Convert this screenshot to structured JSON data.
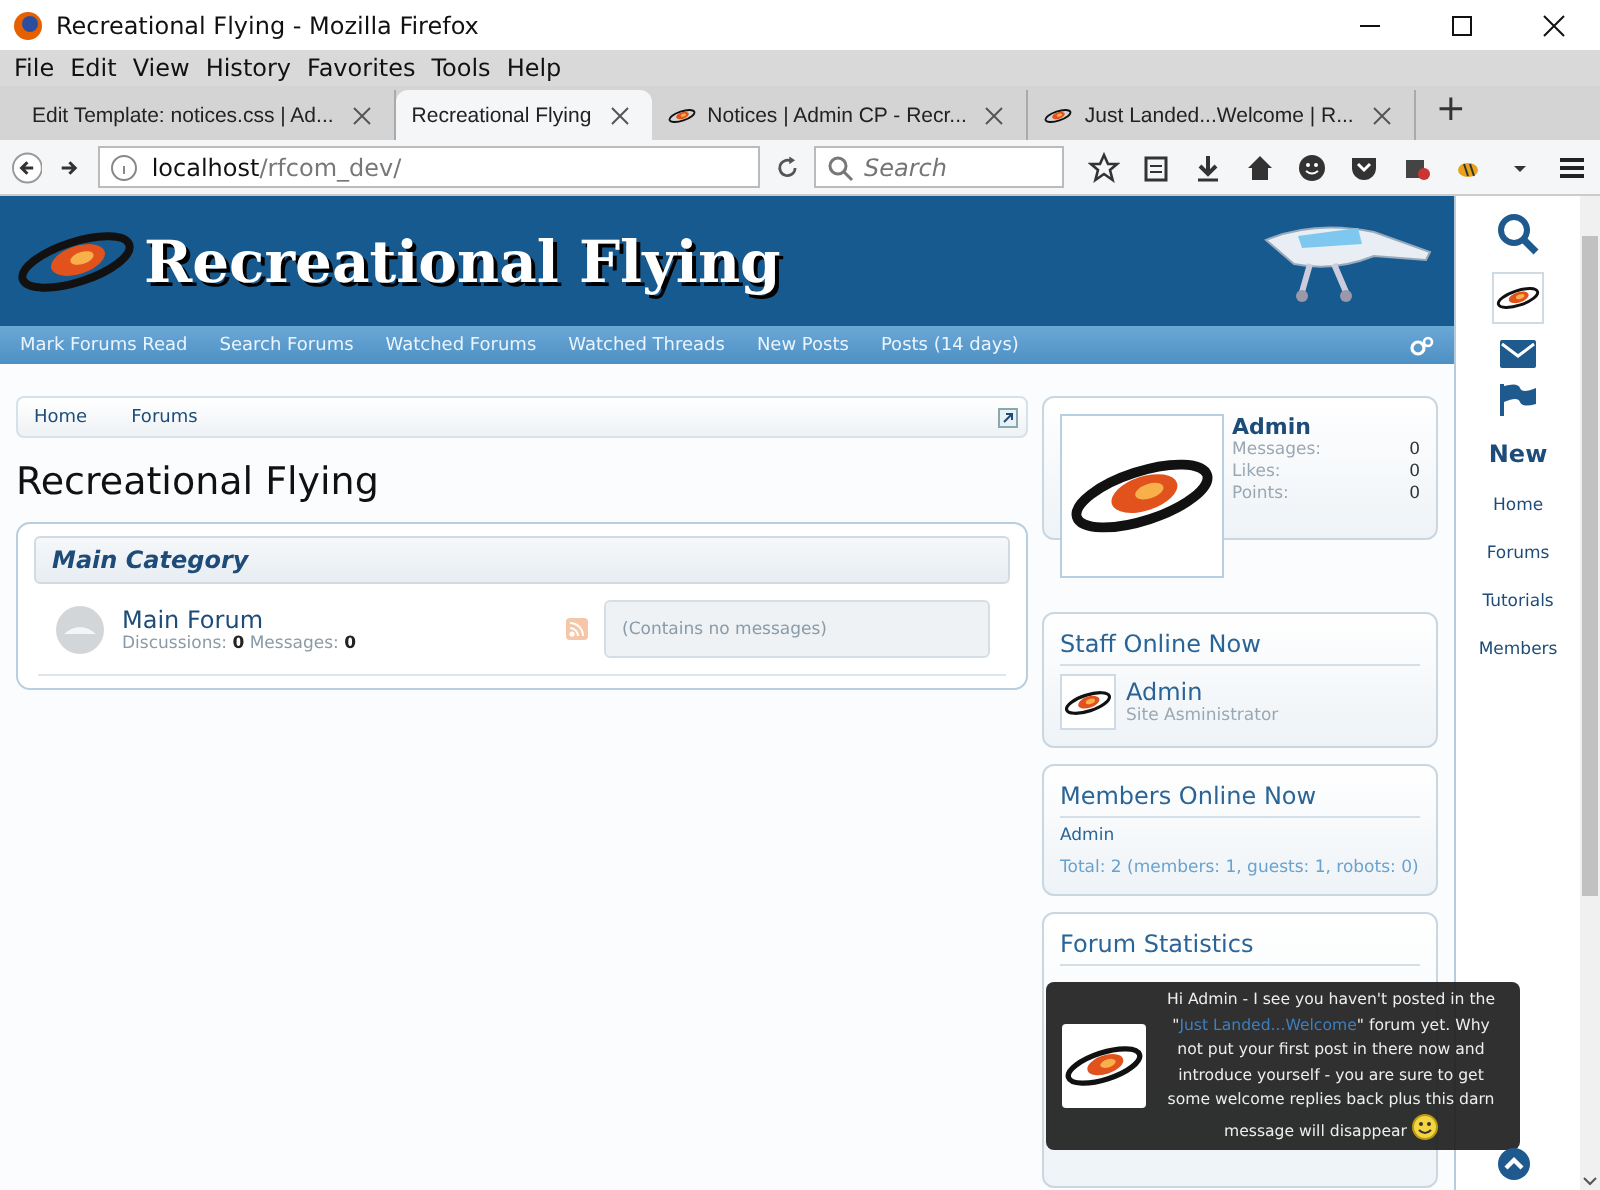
{
  "window": {
    "title": "Recreational Flying - Mozilla Firefox"
  },
  "menu": [
    "File",
    "Edit",
    "View",
    "History",
    "Favorites",
    "Tools",
    "Help"
  ],
  "tabs": [
    {
      "label": "Edit Template: notices.css | Ad...",
      "selected": false,
      "favicon": false
    },
    {
      "label": "Recreational Flying",
      "selected": true,
      "favicon": false
    },
    {
      "label": "Notices | Admin CP - Recr...",
      "selected": false,
      "favicon": true
    },
    {
      "label": "Just Landed...Welcome | R...",
      "selected": false,
      "favicon": true
    }
  ],
  "new_tab": "+",
  "address": {
    "host": "localhost",
    "path": "/rfcom_dev/"
  },
  "search": {
    "placeholder": "Search"
  },
  "site": {
    "title": "Recreational Flying"
  },
  "nav_links": [
    "Mark Forums Read",
    "Search Forums",
    "Watched Forums",
    "Watched Threads",
    "New Posts",
    "Posts (14 days)"
  ],
  "breadcrumbs": [
    "Home",
    "Forums"
  ],
  "page_title": "Recreational Flying",
  "category": {
    "title": "Main Category",
    "forums": [
      {
        "name": "Main Forum",
        "discussions_label": "Discussions:",
        "discussions": "0",
        "messages_label": "Messages:",
        "messages": "0",
        "last_post": "(Contains no messages)"
      }
    ]
  },
  "profile": {
    "name": "Admin",
    "stats": [
      {
        "label": "Messages:",
        "value": "0"
      },
      {
        "label": "Likes:",
        "value": "0"
      },
      {
        "label": "Points:",
        "value": "0"
      }
    ]
  },
  "staff_online": {
    "title": "Staff Online Now",
    "members": [
      {
        "name": "Admin",
        "role": "Site Asministrator"
      }
    ]
  },
  "members_online": {
    "title": "Members Online Now",
    "names": [
      "Admin"
    ],
    "total": "Total: 2 (members: 1, guests: 1, robots: 0)"
  },
  "forum_statistics": {
    "title": "Forum Statistics"
  },
  "side_nav": {
    "new_label": "New",
    "links": [
      "Home",
      "Forums",
      "Tutorials",
      "Members"
    ]
  },
  "notice": {
    "before": "Hi Admin - I see you haven't posted in the \"",
    "link": "Just Landed...Welcome",
    "after": "\" forum yet. Why not put your first post in there now and introduce yourself - you are sure to get some welcome replies back plus this darn message will disappear"
  }
}
